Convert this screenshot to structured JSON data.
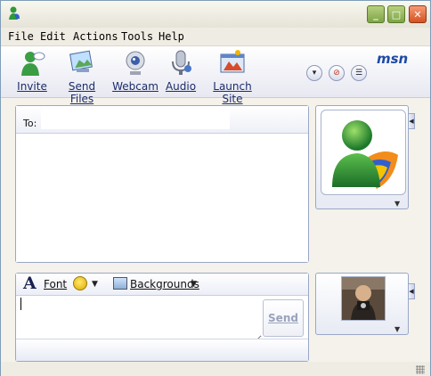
{
  "window": {
    "controls": [
      "minimize-icon",
      "maximize-icon",
      "close-icon"
    ],
    "accent_color": "#7da445",
    "close_color": "#d6521f"
  },
  "menu": [
    "File",
    "Edit",
    "Actions",
    "Tools",
    "Help"
  ],
  "toolbar": {
    "items": [
      {
        "label": "Invite",
        "icon": "invite-icon"
      },
      {
        "label": "Send Files",
        "icon": "send-files-icon"
      },
      {
        "label": "Webcam",
        "icon": "webcam-icon"
      },
      {
        "label": "Audio",
        "icon": "audio-icon"
      },
      {
        "label": "Launch Site",
        "icon": "launch-site-icon"
      }
    ],
    "brand": "msn",
    "right_buttons": [
      "dropdown-icon",
      "block-icon",
      "options-icon"
    ]
  },
  "conversation": {
    "to_label": "To:",
    "to_value": ""
  },
  "compose": {
    "font_label": "Font",
    "emoticon_icon": "smiley-icon",
    "backgrounds_label": "Backgrounds",
    "message_value": "",
    "send_label": "Send"
  },
  "display_pictures": {
    "contact_icon": "msn-buddy-icon",
    "self_icon": "user-photo-icon"
  }
}
